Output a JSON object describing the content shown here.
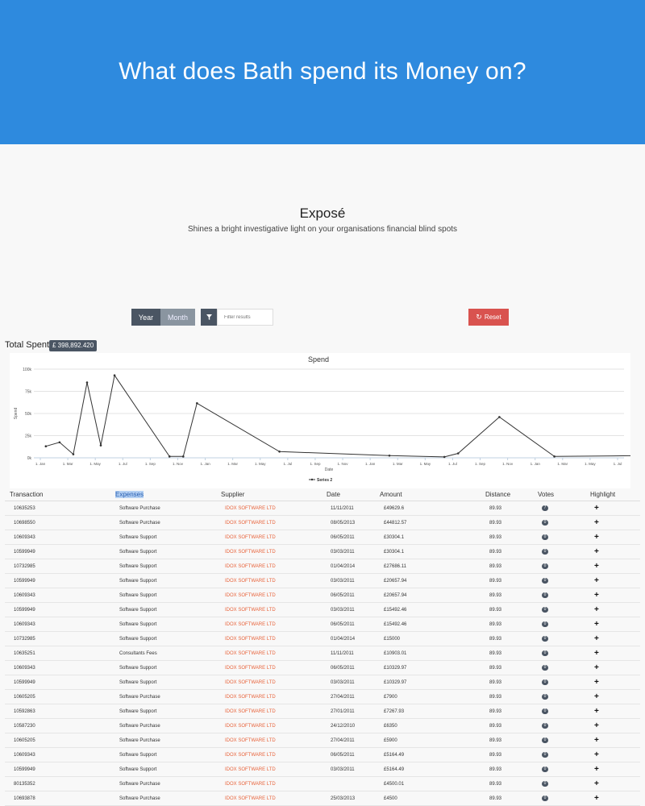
{
  "hero": {
    "title": "What does Bath spend its Money on?"
  },
  "intro": {
    "title": "Exposé",
    "subtitle": "Shines a bright investigative light on your organisations financial blind spots"
  },
  "controls": {
    "year_label": "Year",
    "month_label": "Month",
    "filter_icon": "filter-icon",
    "filter_placeholder": "Filter results",
    "reset_label": "Reset",
    "reset_icon": "refresh-icon"
  },
  "total": {
    "label": "Total Spent",
    "value": "£ 398,892.420"
  },
  "chart_data": {
    "type": "line",
    "title": "Spend",
    "xlabel": "Date",
    "ylabel": "Spend",
    "ylim": [
      0,
      100000
    ],
    "yticks": [
      "0k",
      "25k",
      "50k",
      "75k",
      "100k"
    ],
    "xticks": [
      "1. Jan",
      "1. Mar",
      "1. May",
      "1. Jul",
      "1. Sep",
      "1. Nov",
      "1. Jan",
      "1. Mar",
      "1. May",
      "1. Jul",
      "1. Sep",
      "1. Nov",
      "1. Jan",
      "1. Mar",
      "1. May",
      "1. Jul",
      "1. Sep",
      "1. Nov",
      "1. Jan",
      "1. Mar",
      "1. May",
      "1. Jul"
    ],
    "grid": true,
    "legend": "bottom",
    "series": [
      {
        "name": "Series 2",
        "color": "#333333",
        "points": [
          [
            0.2,
            13000
          ],
          [
            0.7,
            17500
          ],
          [
            1.2,
            4000
          ],
          [
            1.7,
            85000
          ],
          [
            2.2,
            14000
          ],
          [
            2.7,
            93000
          ],
          [
            4.7,
            1500
          ],
          [
            5.2,
            1500
          ],
          [
            5.7,
            61500
          ],
          [
            8.7,
            7000
          ],
          [
            12.7,
            2500
          ],
          [
            14.7,
            1000
          ],
          [
            15.2,
            5000
          ],
          [
            16.7,
            46000
          ],
          [
            18.7,
            1500
          ],
          [
            21.7,
            2500
          ],
          [
            22.2,
            45500
          ],
          [
            22.7,
            1500
          ]
        ]
      }
    ]
  },
  "table": {
    "headers": [
      "Transaction",
      "Expenses",
      "Supplier",
      "Date",
      "Amount",
      "Distance",
      "Votes",
      "Highlight"
    ],
    "rows": [
      [
        "10635253",
        "Software Purchase",
        "IDOX SOFTWARE LTD",
        "11/11/2011",
        "£49629.6",
        "89.93",
        "7",
        "+"
      ],
      [
        "10698550",
        "Software Purchase",
        "IDOX SOFTWARE LTD",
        "08/05/2013",
        "£44812.57",
        "89.93",
        "0",
        "+"
      ],
      [
        "10609343",
        "Software Support",
        "IDOX SOFTWARE LTD",
        "06/05/2011",
        "£30304.1",
        "89.93",
        "0",
        "+"
      ],
      [
        "10599949",
        "Software Support",
        "IDOX SOFTWARE LTD",
        "03/03/2011",
        "£30304.1",
        "89.93",
        "0",
        "+"
      ],
      [
        "10732985",
        "Software Support",
        "IDOX SOFTWARE LTD",
        "01/04/2014",
        "£27686.11",
        "89.93",
        "0",
        "+"
      ],
      [
        "10599949",
        "Software Support",
        "IDOX SOFTWARE LTD",
        "03/03/2011",
        "£20657.94",
        "89.93",
        "0",
        "+"
      ],
      [
        "10609343",
        "Software Support",
        "IDOX SOFTWARE LTD",
        "06/05/2011",
        "£20657.94",
        "89.93",
        "0",
        "+"
      ],
      [
        "10599949",
        "Software Support",
        "IDOX SOFTWARE LTD",
        "03/03/2011",
        "£15492.46",
        "89.93",
        "0",
        "+"
      ],
      [
        "10609343",
        "Software Support",
        "IDOX SOFTWARE LTD",
        "06/05/2011",
        "£15492.46",
        "89.93",
        "0",
        "+"
      ],
      [
        "10732985",
        "Software Support",
        "IDOX SOFTWARE LTD",
        "01/04/2014",
        "£15000",
        "89.93",
        "0",
        "+"
      ],
      [
        "10635251",
        "Consultants Fees",
        "IDOX SOFTWARE LTD",
        "11/11/2011",
        "£10903.01",
        "89.93",
        "0",
        "+"
      ],
      [
        "10609343",
        "Software Support",
        "IDOX SOFTWARE LTD",
        "06/05/2011",
        "£10329.97",
        "89.93",
        "0",
        "+"
      ],
      [
        "10599949",
        "Software Support",
        "IDOX SOFTWARE LTD",
        "03/03/2011",
        "£10329.97",
        "89.93",
        "0",
        "+"
      ],
      [
        "10605205",
        "Software Purchase",
        "IDOX SOFTWARE LTD",
        "27/04/2011",
        "£7900",
        "89.93",
        "0",
        "+"
      ],
      [
        "10592863",
        "Software Support",
        "IDOX SOFTWARE LTD",
        "27/01/2011",
        "£7267.93",
        "89.93",
        "0",
        "+"
      ],
      [
        "10587230",
        "Software Purchase",
        "IDOX SOFTWARE LTD",
        "24/12/2010",
        "£6350",
        "89.93",
        "0",
        "+"
      ],
      [
        "10605205",
        "Software Purchase",
        "IDOX SOFTWARE LTD",
        "27/04/2011",
        "£5900",
        "89.93",
        "0",
        "+"
      ],
      [
        "10609343",
        "Software Support",
        "IDOX SOFTWARE LTD",
        "06/05/2011",
        "£5164.49",
        "89.93",
        "0",
        "+"
      ],
      [
        "10599949",
        "Software Support",
        "IDOX SOFTWARE LTD",
        "03/03/2011",
        "£5164.49",
        "89.93",
        "0",
        "+"
      ],
      [
        "80135352",
        "Software Purchase",
        "IDOX SOFTWARE LTD",
        "",
        "£4500.01",
        "89.93",
        "0",
        "+"
      ],
      [
        "10693878",
        "Software Purchase",
        "IDOX SOFTWARE LTD",
        "25/03/2013",
        "£4500",
        "89.93",
        "0",
        "+"
      ]
    ]
  }
}
